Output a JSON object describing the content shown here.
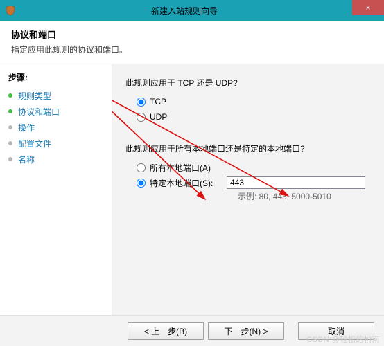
{
  "titlebar": {
    "title": "新建入站规则向导",
    "close_glyph": "×"
  },
  "header": {
    "title": "协议和端口",
    "subtitle": "指定应用此规则的协议和端口。"
  },
  "sidebar": {
    "steps_label": "步骤:",
    "items": [
      {
        "label": "规则类型",
        "bullet": "green"
      },
      {
        "label": "协议和端口",
        "bullet": "green",
        "active": true
      },
      {
        "label": "操作",
        "bullet": "grey"
      },
      {
        "label": "配置文件",
        "bullet": "grey"
      },
      {
        "label": "名称",
        "bullet": "grey"
      }
    ]
  },
  "main": {
    "protocol": {
      "question": "此规则应用于 TCP 还是 UDP?",
      "tcp_label": "TCP",
      "udp_label": "UDP",
      "selected": "tcp"
    },
    "ports": {
      "question": "此规则应用于所有本地端口还是特定的本地端口?",
      "all_label": "所有本地端口(A)",
      "specific_label": "特定本地端口(S):",
      "selected": "specific",
      "value": "443",
      "example": "示例: 80, 443, 5000-5010"
    }
  },
  "footer": {
    "back": "< 上一步(B)",
    "next": "下一步(N) >",
    "cancel": "取消"
  },
  "watermark": "CSDN @轻松的柯南"
}
